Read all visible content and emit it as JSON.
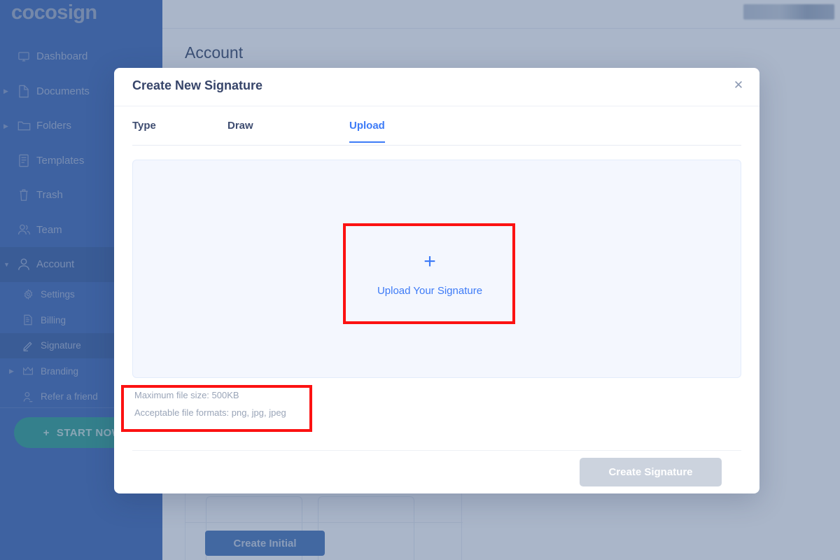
{
  "brand": {
    "logo_text": "cocosign",
    "sidebar_color": "#3360b4",
    "accent_color": "#3d7bf7",
    "cta_color": "#219a8c"
  },
  "sidebar": {
    "items": [
      {
        "label": "Dashboard",
        "icon": "monitor-icon",
        "caret": false,
        "active": false,
        "sub": false
      },
      {
        "label": "Documents",
        "icon": "file-icon",
        "caret": true,
        "active": false,
        "sub": false
      },
      {
        "label": "Folders",
        "icon": "folder-icon",
        "caret": true,
        "active": false,
        "sub": false
      },
      {
        "label": "Templates",
        "icon": "template-icon",
        "caret": false,
        "active": false,
        "sub": false
      },
      {
        "label": "Trash",
        "icon": "trash-icon",
        "caret": false,
        "active": false,
        "sub": false
      },
      {
        "label": "Team",
        "icon": "team-icon",
        "caret": false,
        "active": false,
        "sub": false
      },
      {
        "label": "Account",
        "icon": "user-icon",
        "caret": true,
        "active": true,
        "sub": false
      },
      {
        "label": "Settings",
        "icon": "gear-icon",
        "caret": false,
        "active": false,
        "sub": true
      },
      {
        "label": "Billing",
        "icon": "billing-icon",
        "caret": false,
        "active": false,
        "sub": true
      },
      {
        "label": "Signature",
        "icon": "pen-icon",
        "caret": false,
        "active": true,
        "sub": true
      },
      {
        "label": "Branding",
        "icon": "crown-icon",
        "caret": true,
        "active": false,
        "sub": true
      },
      {
        "label": "Refer a friend",
        "icon": "refer-icon",
        "caret": false,
        "active": false,
        "sub": true
      }
    ],
    "start_now_label": "START NOW",
    "start_now_icon": "plus-icon"
  },
  "background_page": {
    "title": "Account",
    "create_initial_label": "Create Initial"
  },
  "modal": {
    "title": "Create New Signature",
    "close_icon": "close-icon",
    "tabs": [
      {
        "label": "Type",
        "active": false
      },
      {
        "label": "Draw",
        "active": false
      },
      {
        "label": "Upload",
        "active": true
      }
    ],
    "dropzone": {
      "plus_icon": "plus-icon",
      "label": "Upload Your Signature"
    },
    "file_info": {
      "max_size": "Maximum file size: 500KB",
      "formats": "Acceptable file formats: png, jpg, jpeg"
    },
    "submit_label": "Create Signature",
    "submit_disabled": true
  },
  "annotations": {
    "color": "#fc1212",
    "boxes": [
      {
        "name": "upload-dropzone-highlight"
      },
      {
        "name": "file-info-highlight"
      }
    ]
  }
}
